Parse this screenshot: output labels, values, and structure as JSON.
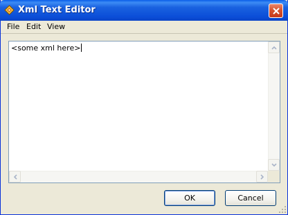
{
  "window": {
    "title": "Xml Text Editor",
    "colors": {
      "titlebar": "#0b4ed8",
      "close": "#d8542f",
      "face": "#ece9d8"
    }
  },
  "icons": {
    "app": "xml-editor-app-icon",
    "close": "close-icon",
    "scroll_up": "arrow-up-icon",
    "scroll_down": "arrow-down-icon",
    "scroll_left": "arrow-left-icon",
    "scroll_right": "arrow-right-icon",
    "grip": "resize-grip-icon"
  },
  "menubar": {
    "items": [
      "File",
      "Edit",
      "View"
    ]
  },
  "editor": {
    "text": "<some xml here>"
  },
  "buttons": {
    "ok": "OK",
    "cancel": "Cancel"
  }
}
